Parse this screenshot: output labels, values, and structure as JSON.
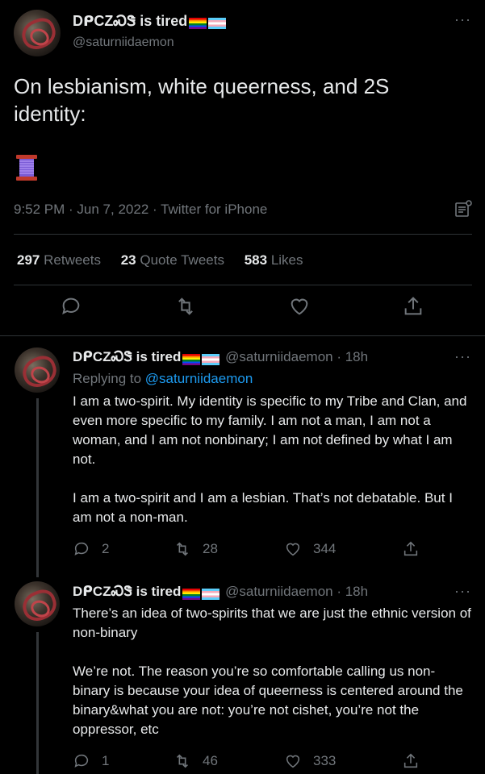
{
  "main_tweet": {
    "display_name": "DᑭCZᏍᏕ is tired",
    "handle": "@saturniidaemon",
    "more_label": "···",
    "text": "On lesbianism, white queerness, and 2S identity:",
    "emoji_name": "thread-spool-icon",
    "meta": "9:52 PM · Jun 7, 2022 · Twitter for iPhone",
    "stats": [
      {
        "count": "297",
        "label": "Retweets"
      },
      {
        "count": "23",
        "label": "Quote Tweets"
      },
      {
        "count": "583",
        "label": "Likes"
      }
    ]
  },
  "replies": [
    {
      "display_name": "DᑭCZᏍᏕ is tired",
      "handle_time": "@saturniidaemon · 18h",
      "replying_prefix": "Replying to ",
      "replying_handle": "@saturniidaemon",
      "paragraphs": [
        "I am a two-spirit. My identity is specific to my Tribe and Clan, and even more specific to my family. I am not a man, I am not a woman, and I am not nonbinary; I am not defined by what I am not.",
        "I am a two-spirit and I am a lesbian. That’s not debatable. But I am not a non-man."
      ],
      "replies_count": "2",
      "retweets_count": "28",
      "likes_count": "344"
    },
    {
      "display_name": "DᑭCZᏍᏕ is tired",
      "handle_time": "@saturniidaemon · 18h",
      "paragraphs": [
        "There’s an idea of two-spirits that we are just the ethnic version of non-binary",
        "We’re not. The reason you’re so comfortable calling us non-binary is because your idea of queerness is centered around the binary&what you are not: you’re not cishet, you’re not the oppressor, etc"
      ],
      "replies_count": "1",
      "retweets_count": "46",
      "likes_count": "333"
    }
  ],
  "colors": {
    "background": "#000000",
    "text": "#e7e9ea",
    "muted": "#71767b",
    "link": "#1d9bf0",
    "divider": "#2f3336"
  }
}
